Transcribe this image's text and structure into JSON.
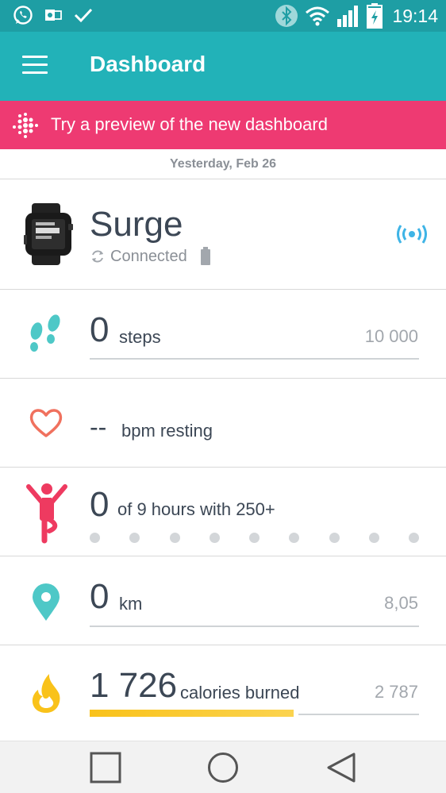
{
  "status_bar": {
    "time": "19:14",
    "icons": [
      "whatsapp-icon",
      "outlook-icon",
      "check-icon",
      "bluetooth-icon",
      "wifi-icon",
      "signal-icon",
      "battery-charging-icon"
    ]
  },
  "app_bar": {
    "title": "Dashboard",
    "menu_icon": "hamburger-menu-icon"
  },
  "banner": {
    "text": "Try a preview of the new dashboard",
    "icon": "fitbit-logo-icon",
    "color": "#ee3a72"
  },
  "date": "Yesterday, Feb 26",
  "device": {
    "name": "Surge",
    "status": "Connected",
    "icons": [
      "watch-image",
      "sync-icon",
      "battery-icon",
      "wireless-sync-icon"
    ]
  },
  "stats": {
    "steps": {
      "value": "0",
      "unit": "steps",
      "goal": "10 000",
      "progress": 0,
      "color": "#4ec8c7"
    },
    "heart": {
      "value": "--",
      "unit": "bpm resting",
      "color": "#f0715e"
    },
    "hourly": {
      "value": "0",
      "unit": "of 9 hours with 250+",
      "hours_total": 9,
      "hours_done": 0,
      "color": "#ee3a60"
    },
    "distance": {
      "value": "0",
      "unit": "km",
      "goal": "8,05",
      "progress": 0,
      "color": "#4ec8c7"
    },
    "calories": {
      "value": "1 726",
      "unit": "calories burned",
      "goal": "2 787",
      "progress": 0.62,
      "color": "#f9c21a"
    }
  },
  "nav": {
    "recent_apps": "square-icon",
    "home": "circle-icon",
    "back": "back-triangle-icon"
  }
}
